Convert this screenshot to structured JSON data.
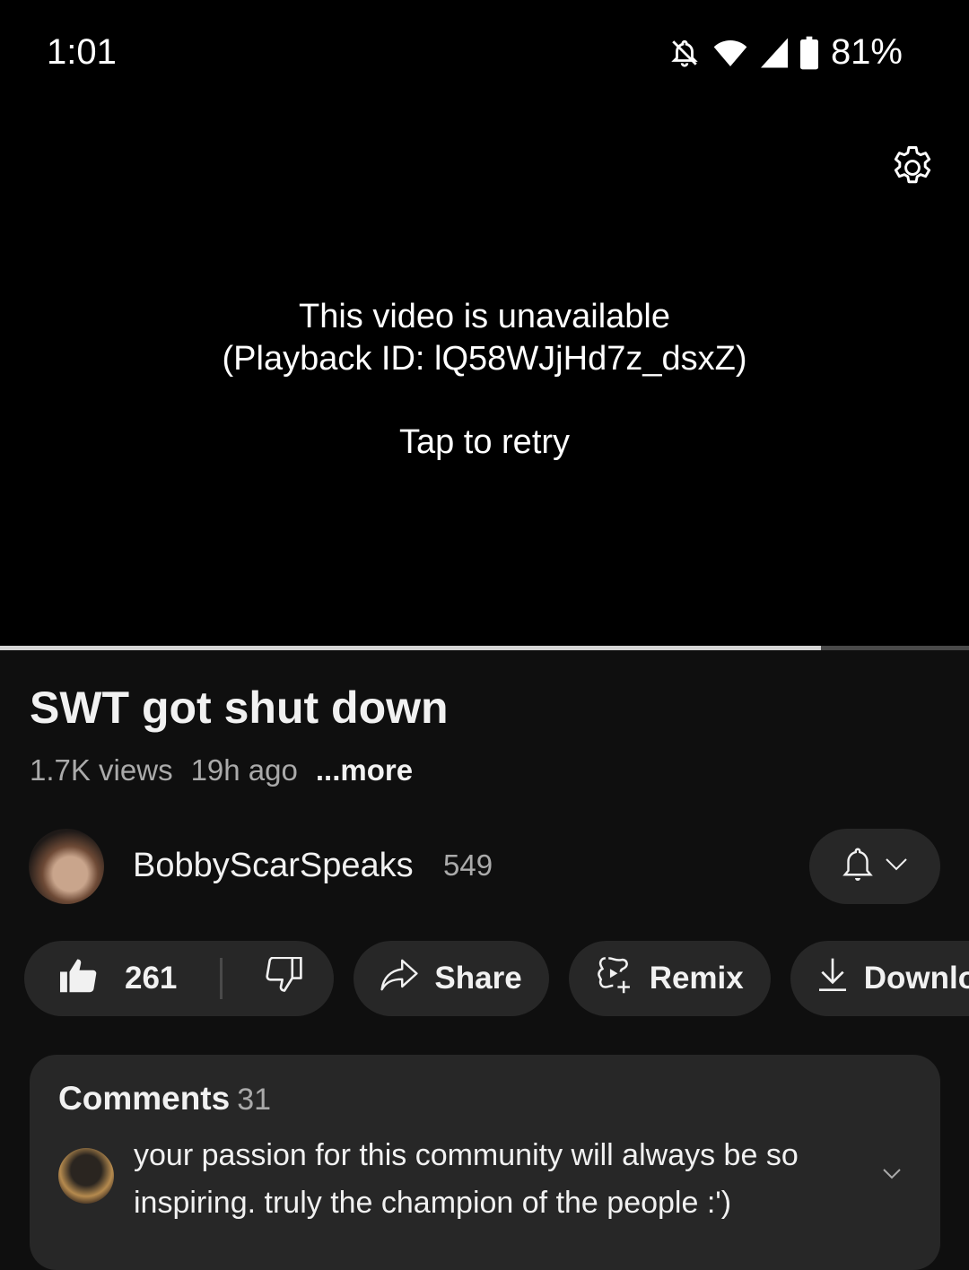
{
  "status_bar": {
    "time": "1:01",
    "icons": [
      "notifications-off-icon",
      "wifi-icon",
      "cellular-signal-icon",
      "battery-icon"
    ],
    "battery": "81%"
  },
  "player": {
    "settings_icon": "gear-icon",
    "error_line1": "This video is unavailable",
    "error_line2": "(Playback ID: lQ58WJjHd7z_dsxZ)",
    "retry_label": "Tap to retry",
    "progress_fraction": 0.847
  },
  "video": {
    "title": "SWT got shut down",
    "views": "1.7K views",
    "age": "19h ago",
    "more_label": "...more"
  },
  "channel": {
    "name": "BobbyScarSpeaks",
    "subscribers": "549",
    "bell_icon": "bell-icon",
    "dropdown_icon": "chevron-down-icon"
  },
  "actions": {
    "like_count": "261",
    "share_label": "Share",
    "remix_label": "Remix",
    "download_label": "Download"
  },
  "comments": {
    "label": "Comments",
    "count": "31",
    "top_comment": "your passion for this community will always be so inspiring. truly the champion of the people :')"
  },
  "colors": {
    "background": "#0f0f0f",
    "pill": "#272727",
    "secondary_text": "#aaaaaa",
    "progress_fill": "#d4d4d4",
    "progress_track": "#4a4a4a"
  }
}
